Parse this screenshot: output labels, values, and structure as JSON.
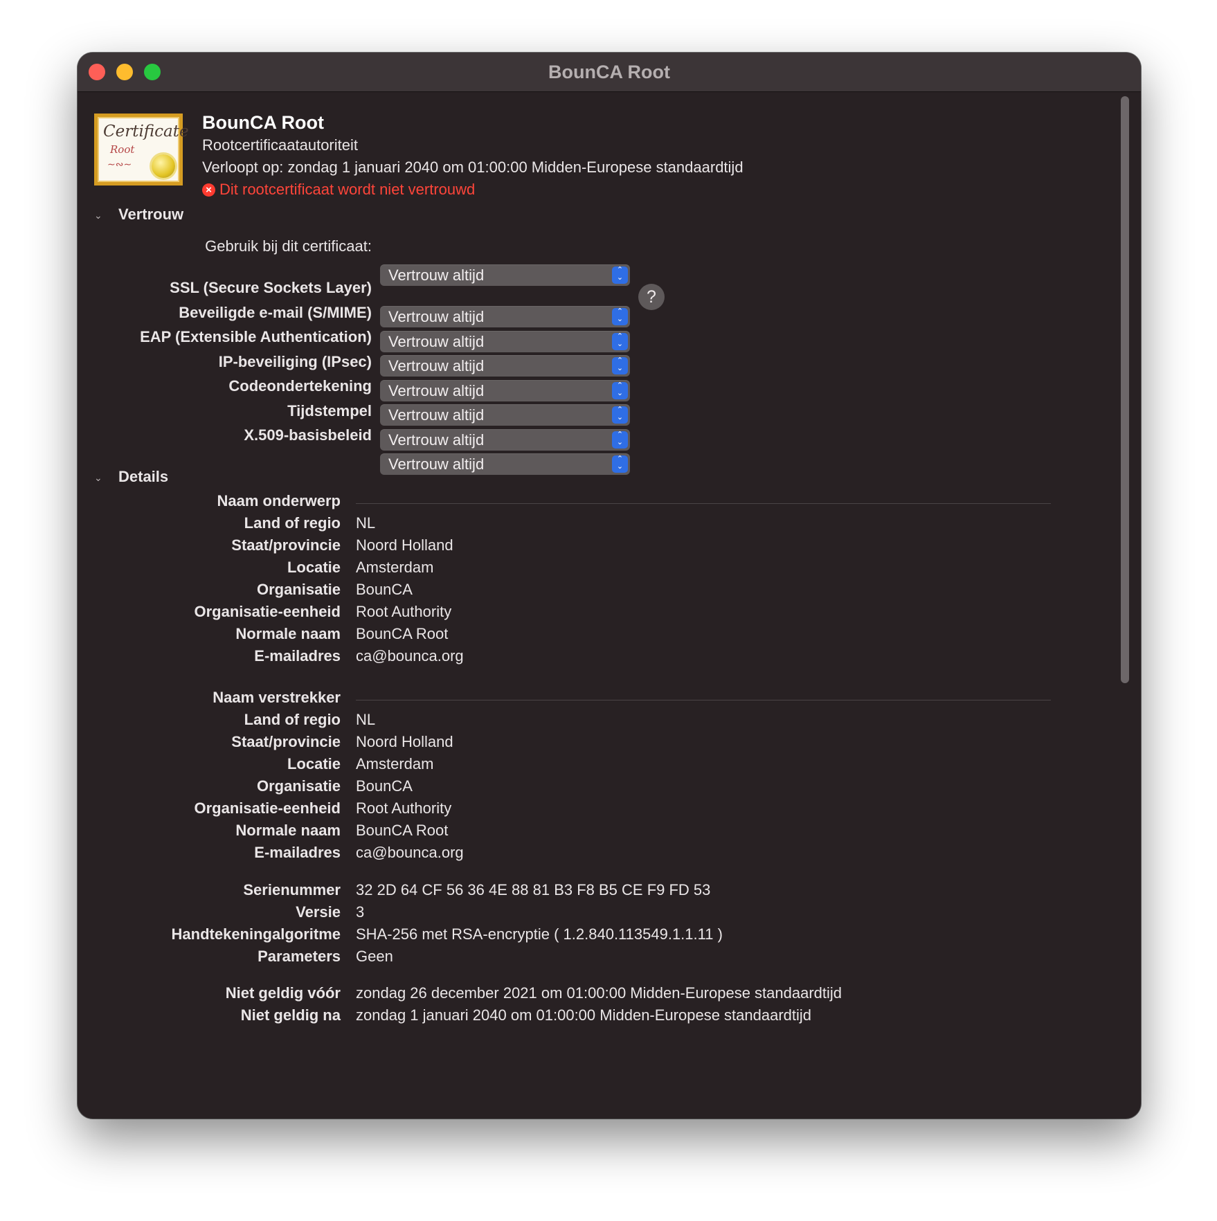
{
  "window": {
    "title": "BounCA Root"
  },
  "certificate": {
    "icon": {
      "heading": "Certificate",
      "subheading": "Root"
    },
    "name": "BounCA Root",
    "type": "Rootcertificaatautoriteit",
    "expires": "Verloopt op: zondag 1 januari 2040 om 01:00:00 Midden-Europese standaardtijd",
    "warning": "Dit rootcertificaat wordt niet vertrouwd"
  },
  "trust": {
    "title": "Vertrouw",
    "use_label": "Gebruik bij dit certificaat:",
    "use_value": "Vertrouw altijd",
    "help": "?",
    "rows": [
      {
        "label": "SSL (Secure Sockets Layer)",
        "value": "Vertrouw altijd"
      },
      {
        "label": "Beveiligde e-mail (S/MIME)",
        "value": "Vertrouw altijd"
      },
      {
        "label": "EAP (Extensible Authentication)",
        "value": "Vertrouw altijd"
      },
      {
        "label": "IP-beveiliging (IPsec)",
        "value": "Vertrouw altijd"
      },
      {
        "label": "Codeondertekening",
        "value": "Vertrouw altijd"
      },
      {
        "label": "Tijdstempel",
        "value": "Vertrouw altijd"
      },
      {
        "label": "X.509-basisbeleid",
        "value": "Vertrouw altijd"
      }
    ]
  },
  "details": {
    "title": "Details",
    "subject": {
      "title": "Naam onderwerp",
      "rows": [
        {
          "label": "Land of regio",
          "value": "NL"
        },
        {
          "label": "Staat/provincie",
          "value": "Noord Holland"
        },
        {
          "label": "Locatie",
          "value": "Amsterdam"
        },
        {
          "label": "Organisatie",
          "value": "BounCA"
        },
        {
          "label": "Organisatie-eenheid",
          "value": "Root Authority"
        },
        {
          "label": "Normale naam",
          "value": "BounCA Root"
        },
        {
          "label": "E-mailadres",
          "value": "ca@bounca.org"
        }
      ]
    },
    "issuer": {
      "title": "Naam verstrekker",
      "rows": [
        {
          "label": "Land of regio",
          "value": "NL"
        },
        {
          "label": "Staat/provincie",
          "value": "Noord Holland"
        },
        {
          "label": "Locatie",
          "value": "Amsterdam"
        },
        {
          "label": "Organisatie",
          "value": "BounCA"
        },
        {
          "label": "Organisatie-eenheid",
          "value": "Root Authority"
        },
        {
          "label": "Normale naam",
          "value": "BounCA Root"
        },
        {
          "label": "E-mailadres",
          "value": "ca@bounca.org"
        }
      ]
    },
    "misc": [
      {
        "label": "Serienummer",
        "value": "32 2D 64 CF 56 36 4E 88 81 B3 F8 B5 CE F9 FD 53"
      },
      {
        "label": "Versie",
        "value": "3"
      },
      {
        "label": "Handtekeningalgoritme",
        "value": "SHA-256 met RSA-encryptie ( 1.2.840.113549.1.1.11 )"
      },
      {
        "label": "Parameters",
        "value": "Geen"
      }
    ],
    "validity": [
      {
        "label": "Niet geldig vóór",
        "value": "zondag 26 december 2021 om 01:00:00 Midden-Europese standaardtijd"
      },
      {
        "label": "Niet geldig na",
        "value": "zondag 1 januari 2040 om 01:00:00 Midden-Europese standaardtijd"
      }
    ]
  },
  "colors": {
    "window_bg": "#282123",
    "titlebar_bg": "#3c3537",
    "warning": "#ff453a",
    "accent": "#2f6ee5",
    "close": "#fe5f57",
    "minimize": "#febc2e",
    "maximize": "#28c840"
  }
}
